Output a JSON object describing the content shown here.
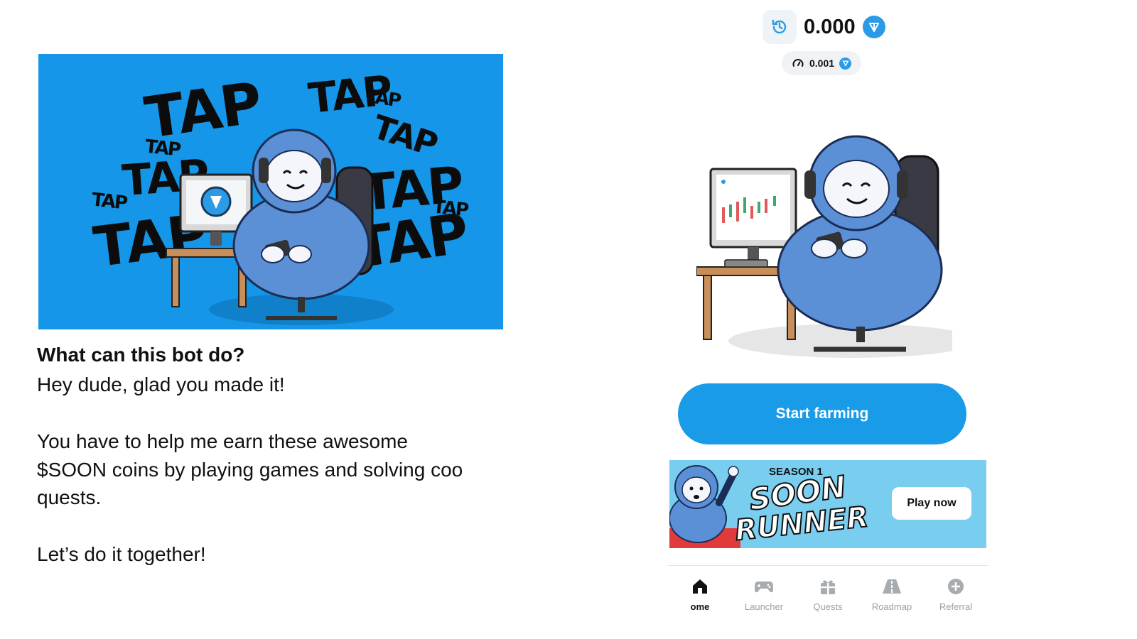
{
  "bot_intro": {
    "hero_words": [
      "TAP",
      "TAP",
      "TAP",
      "TAP",
      "TAP",
      "TAP",
      "TAP",
      "TAP",
      "TAP",
      "TAP",
      "TAP"
    ],
    "heading": "What can this bot do?",
    "line1": "Hey dude, glad you made it!",
    "line2": "You have to help me earn these awesome",
    "line3": "$SOON coins by playing games and solving coo",
    "line4": "quests.",
    "line5": "Let’s do it together!"
  },
  "app": {
    "balance": "0.000",
    "rate": "0.001",
    "start_button": "Start farming",
    "banner": {
      "season": "SEASON 1",
      "title_line1": "SOON",
      "title_line2": "RUNNER",
      "play_button": "Play now"
    },
    "nav": [
      {
        "label": "ome",
        "icon": "home-icon",
        "active": true
      },
      {
        "label": "Launcher",
        "icon": "gamepad-icon",
        "active": false
      },
      {
        "label": "Quests",
        "icon": "gift-icon",
        "active": false
      },
      {
        "label": "Roadmap",
        "icon": "road-icon",
        "active": false
      },
      {
        "label": "Referral",
        "icon": "plus-circle-icon",
        "active": false
      }
    ]
  },
  "colors": {
    "accent_blue": "#1a9be8",
    "hero_bg": "#1596e8",
    "banner_bg": "#79cdee",
    "nav_inactive": "#9aa0a6"
  }
}
